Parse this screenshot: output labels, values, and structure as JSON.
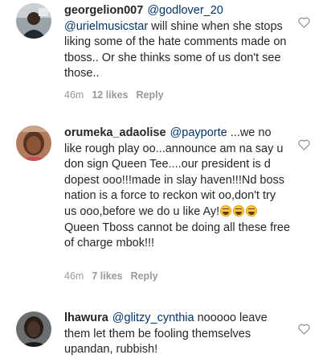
{
  "comments": [
    {
      "username": "georgelion007",
      "mention": "@godlover_20 @urielmusicstar",
      "text": " will shine when she stops liking some of the hate comments made on tboss.. Or she thinks some of us don't see those..",
      "time": "46m",
      "likes": "12 likes",
      "reply": "Reply"
    },
    {
      "username": "orumeka_adaolise",
      "mention": "@payporte",
      "text_before_emoji": " ...we no like rough play oo...announce am na say u don sign Queen Tee....our president is d dopest ooo!!!made in slay haven!!!Nd boss nation is a force to reckon wit oo,don't try us ooo,before we do u like Ay!",
      "emoji": [
        "grinning-sweat-emoji",
        "grinning-sweat-emoji",
        "grinning-sweat-emoji"
      ],
      "text_after_emoji": "Queen Tboss cannot be doing all these free of charge mbok!!!",
      "time": "46m",
      "likes": "7 likes",
      "reply": "Reply"
    },
    {
      "username": "lhawura",
      "mention": "@glitzy_cynthia",
      "text": " nooooo leave them let them be fooling themselves upandan, rubbish!"
    }
  ],
  "icons": {
    "like": "heart-outline-icon"
  },
  "colors": {
    "text": "#262626",
    "mention": "#003569",
    "meta": "#999999"
  }
}
